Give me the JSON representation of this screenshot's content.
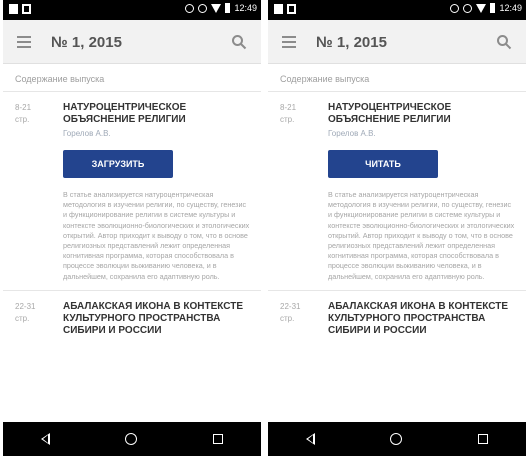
{
  "screens": [
    {
      "status": {
        "time": "12:49"
      },
      "appbar": {
        "title": "№ 1, 2015"
      },
      "section_label": "Содержание выпуска",
      "articles": [
        {
          "pages": "8-21",
          "pages_suffix": "стр.",
          "title": "НАТУРОЦЕНТРИЧЕСКОЕ ОБЪЯСНЕНИЕ РЕЛИГИИ",
          "author": "Горелов А.В.",
          "button": "ЗАГРУЗИТЬ",
          "abstract": "В статье анализируется натуроцентрическая методология в изучении религии, по существу, генезис и функционирование религии в системе культуры и контексте эволюционно-биологических и этологических открытий. Автор приходит к выводу о том, что в основе религиозных представлений лежит определенная когнитивная программа, которая способствовала в процессе эволюции выживанию человека, и в дальнейшем, сохранила его адаптивную роль."
        },
        {
          "pages": "22-31",
          "pages_suffix": "стр.",
          "title": "АБАЛАКСКАЯ ИКОНА В КОНТЕКСТЕ КУЛЬТУРНОГО ПРОСТРАНСТВА СИБИРИ И РОССИИ"
        }
      ]
    },
    {
      "status": {
        "time": "12:49"
      },
      "appbar": {
        "title": "№ 1, 2015"
      },
      "section_label": "Содержание выпуска",
      "articles": [
        {
          "pages": "8-21",
          "pages_suffix": "стр.",
          "title": "НАТУРОЦЕНТРИЧЕСКОЕ ОБЪЯСНЕНИЕ РЕЛИГИИ",
          "author": "Горелов А.В.",
          "button": "ЧИТАТЬ",
          "abstract": "В статье анализируется натуроцентрическая методология в изучении религии, по существу, генезис и функционирование религии в системе культуры и контексте эволюционно-биологических и этологических открытий. Автор приходит к выводу о том, что в основе религиозных представлений лежит определенная когнитивная программа, которая способствовала в процессе эволюции выживанию человека, и в дальнейшем, сохранила его адаптивную роль."
        },
        {
          "pages": "22-31",
          "pages_suffix": "стр.",
          "title": "АБАЛАКСКАЯ ИКОНА В КОНТЕКСТЕ КУЛЬТУРНОГО ПРОСТРАНСТВА СИБИРИ И РОССИИ"
        }
      ]
    }
  ],
  "colors": {
    "accent": "#23448e",
    "statusbar": "#000000",
    "appbar": "#f2f2f2"
  }
}
